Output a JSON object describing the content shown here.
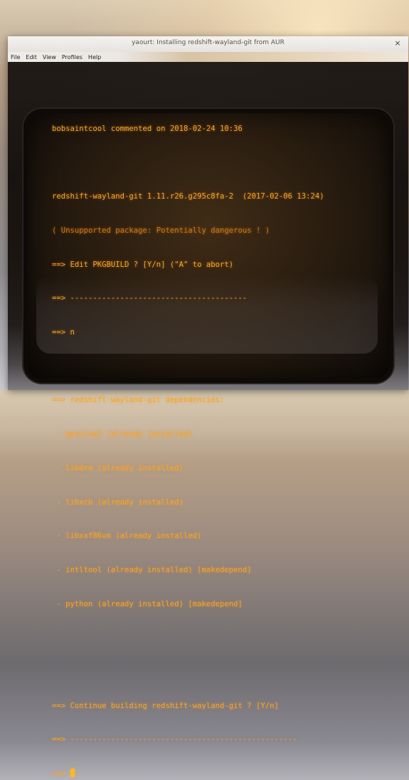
{
  "window": {
    "title": "yaourt: Installing redshift-wayland-git from AUR",
    "close_glyph": "×"
  },
  "menubar": {
    "items": [
      "File",
      "Edit",
      "View",
      "Profiles",
      "Help"
    ]
  },
  "terminal": {
    "lines": [
      "bobsaintcool commented on 2018-02-24 10:36",
      "",
      "redshift-wayland-git 1.11.r26.g295c8fa-2  (2017-02-06 13:24)",
      "( Unsupported package: Potentially dangerous ! )",
      "==> Edit PKGBUILD ? [Y/n] (\"A\" to abort)",
      "==> ---------------------------------------",
      "==> n",
      "",
      "==> redshift-wayland-git dependencies:",
      " - geoclue2 (already installed)",
      " - libdrm (already installed)",
      " - libxcb (already installed)",
      " - libxxf86vm (already installed)",
      " - intltool (already installed) [makedepend]",
      " - python (already installed) [makedepend]",
      "",
      "",
      "==> Continue building redshift-wayland-git ? [Y/n]",
      "==> --------------------------------------------------",
      "==> "
    ]
  },
  "colors": {
    "amber": "#f4a628",
    "background": "#1a1410"
  }
}
